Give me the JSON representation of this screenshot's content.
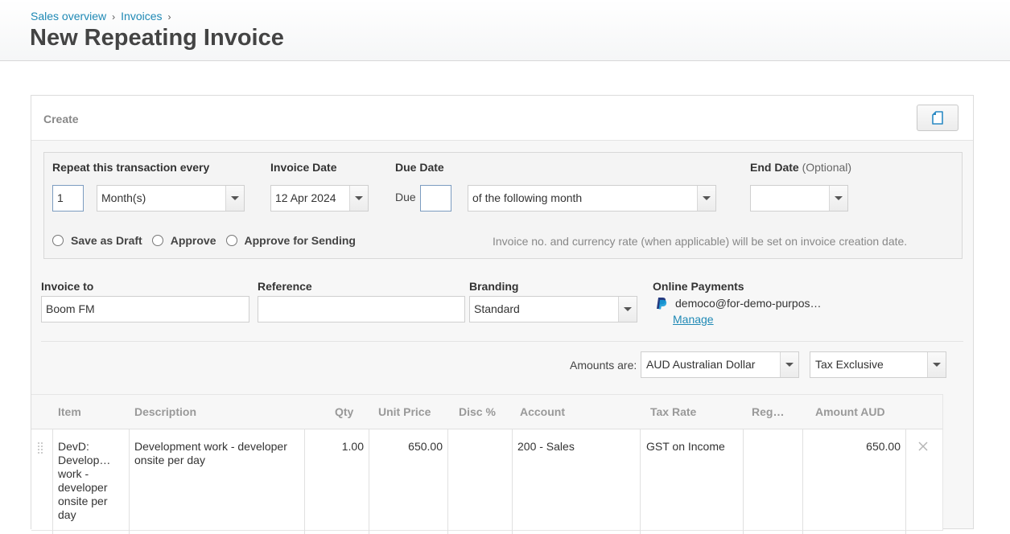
{
  "breadcrumb": [
    {
      "label": "Sales overview"
    },
    {
      "label": "Invoices"
    }
  ],
  "breadcrumb_separator": "›",
  "page_title": "New Repeating Invoice",
  "panel": {
    "title": "Create",
    "doc_button_icon": "document-icon"
  },
  "repeat": {
    "label": "Repeat this transaction every",
    "interval_value": "1",
    "period_value": "Month(s)",
    "invoice_date_label": "Invoice Date",
    "invoice_date_value": "12 Apr 2024",
    "due_date_label": "Due Date",
    "due_prefix": "Due",
    "due_day_value": "",
    "due_terms_value": "of the following month",
    "end_date_label": "End Date",
    "end_date_optional": "(Optional)",
    "end_date_value": "",
    "save_options": [
      {
        "label": "Save as Draft",
        "checked": false
      },
      {
        "label": "Approve",
        "checked": false
      },
      {
        "label": "Approve for Sending",
        "checked": false
      }
    ],
    "note": "Invoice no. and currency rate (when applicable) will be set on invoice creation date."
  },
  "details": {
    "invoice_to_label": "Invoice to",
    "invoice_to_value": "Boom FM",
    "reference_label": "Reference",
    "reference_value": "",
    "branding_label": "Branding",
    "branding_value": "Standard",
    "online_payments_label": "Online Payments",
    "online_payments_account": "democo@for-demo-purpos…",
    "online_payments_manage": "Manage"
  },
  "amounts": {
    "label": "Amounts are:",
    "currency_value": "AUD Australian Dollar",
    "tax_mode_value": "Tax Exclusive"
  },
  "table": {
    "headers": [
      "Item",
      "Description",
      "Qty",
      "Unit Price",
      "Disc %",
      "Account",
      "Tax Rate",
      "Reg…",
      "Amount AUD"
    ],
    "rows": [
      {
        "item": "DevD: Develop… work - developer onsite per day",
        "description": "Development work - developer onsite per day",
        "qty": "1.00",
        "unit_price": "650.00",
        "disc": "",
        "account": "200 - Sales",
        "tax_rate": "GST on Income",
        "region": "",
        "amount": "650.00"
      }
    ]
  },
  "colors": {
    "link": "#1f89b5",
    "title": "#444444",
    "paypal_dark": "#253b80",
    "paypal_light": "#179bd7"
  }
}
